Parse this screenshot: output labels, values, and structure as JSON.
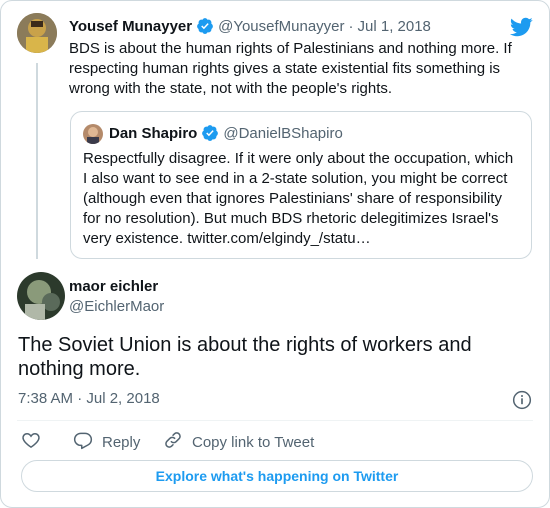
{
  "parent_tweet": {
    "author_name": "Yousef Munayyer",
    "author_handle": "@YousefMunayyer",
    "date": "Jul 1, 2018",
    "text": "BDS is about the human rights of Palestinians and nothing more. If respecting human rights gives a state existential fits something is wrong with the state, not with the people's rights."
  },
  "quoted_tweet": {
    "author_name": "Dan Shapiro",
    "author_handle": "@DanielBShapiro",
    "text": "Respectfully disagree. If it were only about the occupation, which I also want to see end in a 2-state solution, you might be correct (although even that ignores Palestinians' share of responsibility for no resolution). But much BDS rhetoric delegitimizes Israel's very existence. twitter.com/elgindy_/statu…"
  },
  "main_tweet": {
    "author_name": "maor eichler",
    "author_handle": "@EichlerMaor",
    "text": "The Soviet Union is about the rights of workers and nothing more.",
    "timestamp": "7:38 AM · Jul 2, 2018"
  },
  "actions": {
    "reply_label": "Reply",
    "copy_link_label": "Copy link to Tweet"
  },
  "explore_label": "Explore what's happening on Twitter",
  "colors": {
    "brand_blue": "#1d9bf0",
    "text": "#0f1419",
    "secondary_text": "#536471",
    "border": "#cfd9de"
  },
  "icons": [
    "twitter-bird-icon",
    "verified-badge-icon",
    "info-icon",
    "heart-icon",
    "reply-icon",
    "link-icon"
  ]
}
